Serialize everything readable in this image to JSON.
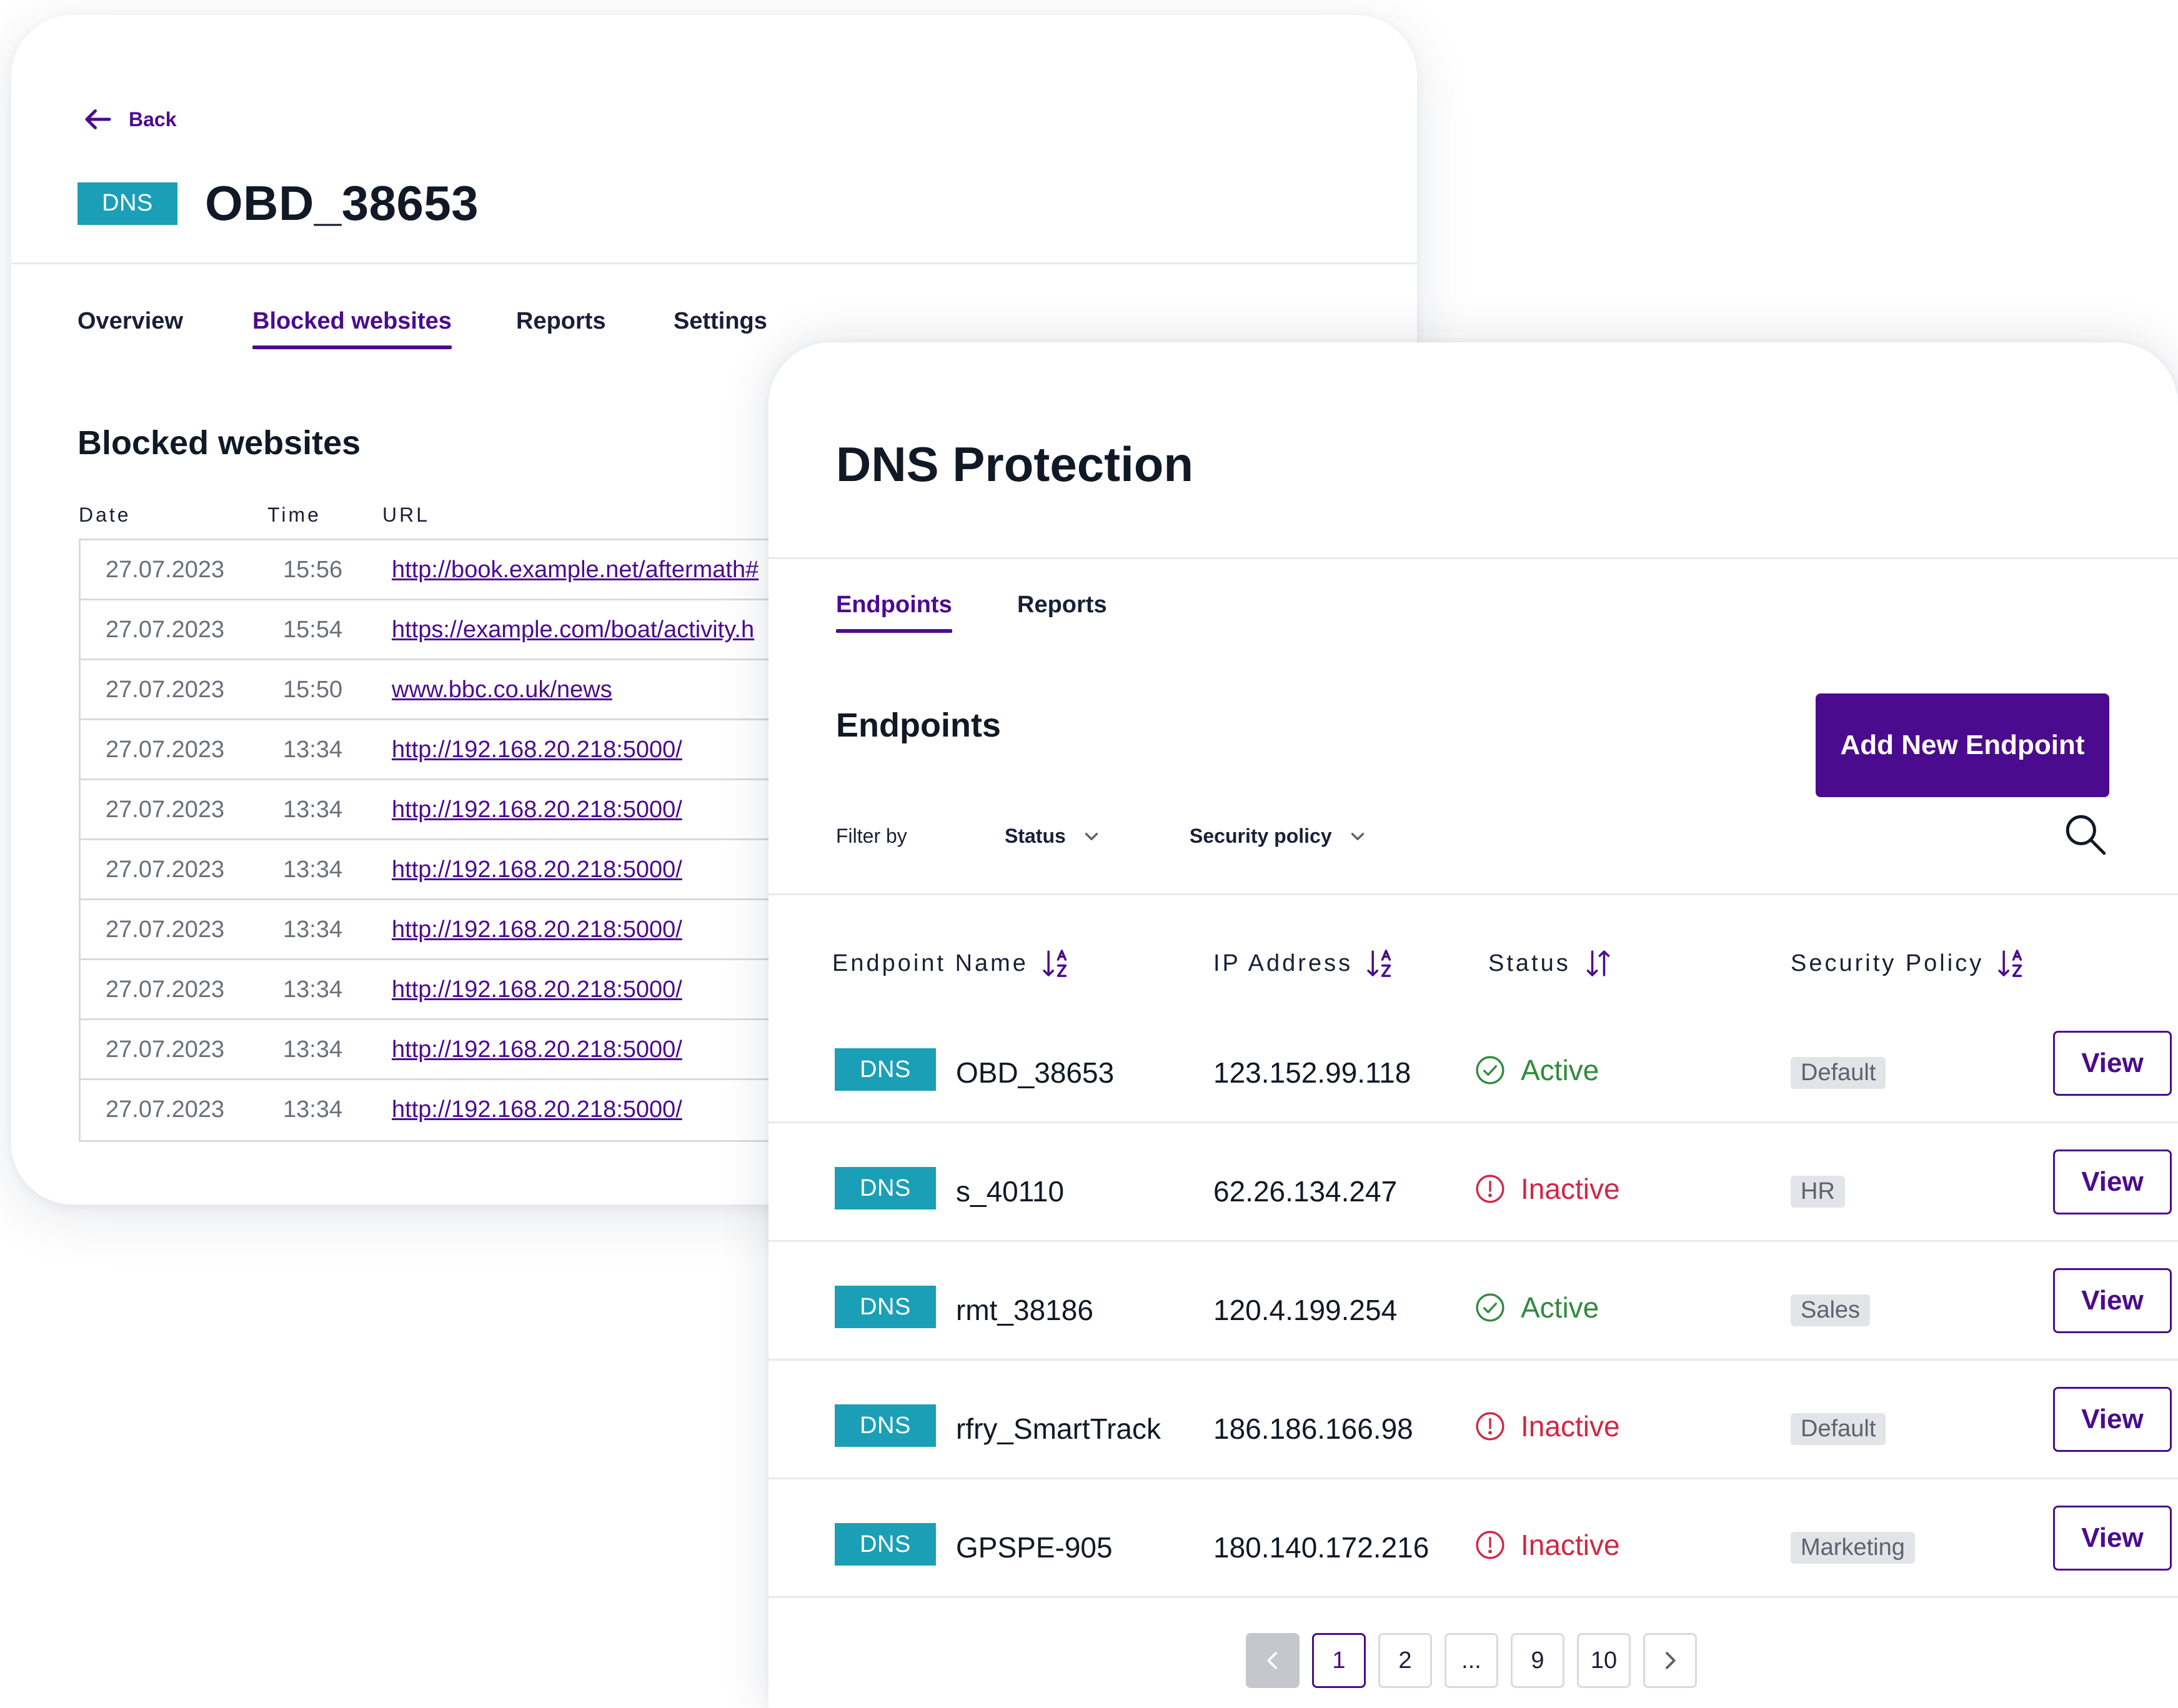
{
  "detail": {
    "back_label": "Back",
    "badge": "DNS",
    "title": "OBD_38653",
    "tabs": [
      {
        "label": "Overview"
      },
      {
        "label": "Blocked websites"
      },
      {
        "label": "Reports"
      },
      {
        "label": "Settings"
      }
    ],
    "active_tab": "Blocked websites",
    "section_title": "Blocked websites",
    "columns": {
      "date": "Date",
      "time": "Time",
      "url": "URL"
    },
    "rows": [
      {
        "date": "27.07.2023",
        "time": "15:56",
        "url": "http://book.example.net/aftermath#"
      },
      {
        "date": "27.07.2023",
        "time": "15:54",
        "url": "https://example.com/boat/activity.h"
      },
      {
        "date": "27.07.2023",
        "time": "15:50",
        "url": "www.bbc.co.uk/news"
      },
      {
        "date": "27.07.2023",
        "time": "13:34",
        "url": "http://192.168.20.218:5000/"
      },
      {
        "date": "27.07.2023",
        "time": "13:34",
        "url": "http://192.168.20.218:5000/"
      },
      {
        "date": "27.07.2023",
        "time": "13:34",
        "url": "http://192.168.20.218:5000/"
      },
      {
        "date": "27.07.2023",
        "time": "13:34",
        "url": "http://192.168.20.218:5000/"
      },
      {
        "date": "27.07.2023",
        "time": "13:34",
        "url": "http://192.168.20.218:5000/"
      },
      {
        "date": "27.07.2023",
        "time": "13:34",
        "url": "http://192.168.20.218:5000/"
      },
      {
        "date": "27.07.2023",
        "time": "13:34",
        "url": "http://192.168.20.218:5000/"
      }
    ]
  },
  "protection": {
    "title": "DNS Protection",
    "tabs": [
      {
        "label": "Endpoints"
      },
      {
        "label": "Reports"
      }
    ],
    "active_tab": "Endpoints",
    "section_title": "Endpoints",
    "add_button": "Add New Endpoint",
    "filter_label": "Filter by",
    "filters": [
      {
        "label": "Status"
      },
      {
        "label": "Security policy"
      }
    ],
    "columns": {
      "name": "Endpoint Name",
      "ip": "IP Address",
      "status": "Status",
      "policy": "Security Policy"
    },
    "rows": [
      {
        "badge": "DNS",
        "name": "OBD_38653",
        "ip": "123.152.99.118",
        "status": "Active",
        "status_icon": "check-circle-icon",
        "policy": "Default",
        "action": "View"
      },
      {
        "badge": "DNS",
        "name": "s_40110",
        "ip": "62.26.134.247",
        "status": "Inactive",
        "status_icon": "alert-circle-icon",
        "policy": "HR",
        "action": "View"
      },
      {
        "badge": "DNS",
        "name": "rmt_38186",
        "ip": "120.4.199.254",
        "status": "Active",
        "status_icon": "check-circle-icon",
        "policy": "Sales",
        "action": "View"
      },
      {
        "badge": "DNS",
        "name": "rfry_SmartTrack",
        "ip": "186.186.166.98",
        "status": "Inactive",
        "status_icon": "alert-circle-icon",
        "policy": "Default",
        "action": "View"
      },
      {
        "badge": "DNS",
        "name": "GPSPE-905",
        "ip": "180.140.172.216",
        "status": "Inactive",
        "status_icon": "alert-circle-icon",
        "policy": "Marketing",
        "action": "View"
      }
    ],
    "pagination": {
      "pages": [
        "1",
        "2",
        "...",
        "9",
        "10"
      ],
      "current": "1"
    }
  },
  "colors": {
    "brand_purple": "#4b0b8f",
    "dns_badge": "#1a9fb7",
    "active_green": "#2f8a3c",
    "inactive_red": "#d12645",
    "policy_tag_bg": "#e3e4e8"
  }
}
